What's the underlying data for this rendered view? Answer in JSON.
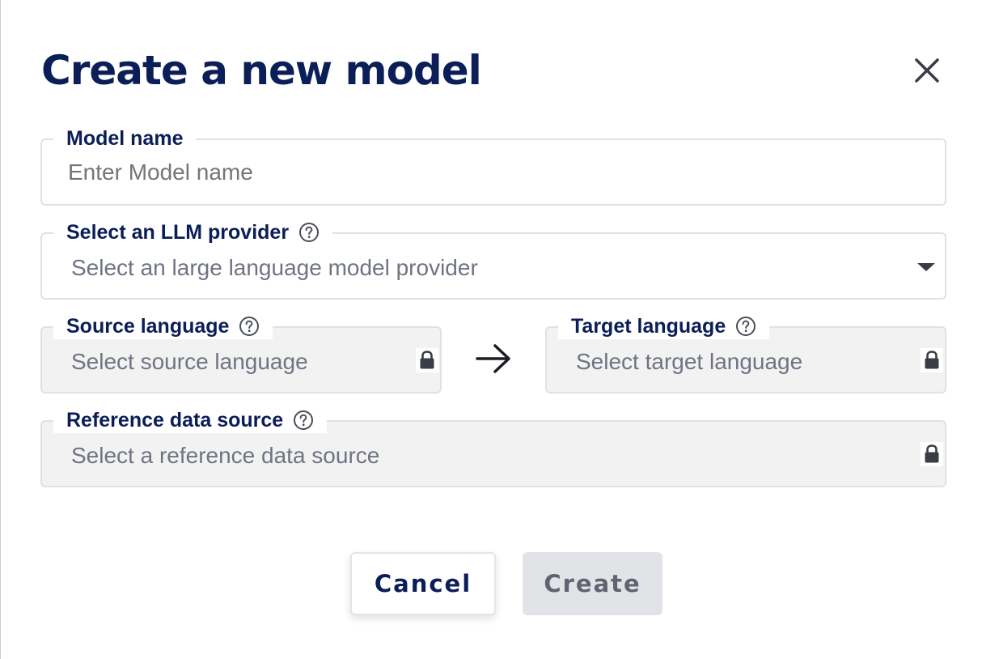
{
  "dialog": {
    "title": "Create a new model",
    "close_icon": "close-icon"
  },
  "fields": {
    "model_name": {
      "label": "Model name",
      "placeholder": "Enter Model name",
      "value": ""
    },
    "llm_provider": {
      "label": "Select an LLM provider",
      "placeholder": "Select an large language model provider",
      "help_icon": "help-icon",
      "dropdown_icon": "caret-down-icon"
    },
    "source_language": {
      "label": "Source language",
      "placeholder": "Select source language",
      "help_icon": "help-icon",
      "lock_icon": "lock-icon",
      "locked": true
    },
    "target_language": {
      "label": "Target language",
      "placeholder": "Select target language",
      "help_icon": "help-icon",
      "lock_icon": "lock-icon",
      "locked": true
    },
    "reference_source": {
      "label": "Reference data source",
      "placeholder": "Select a reference data source",
      "help_icon": "help-icon",
      "lock_icon": "lock-icon",
      "locked": true
    }
  },
  "language_arrow_icon": "arrow-right-icon",
  "buttons": {
    "cancel": "Cancel",
    "create": "Create",
    "create_disabled": true
  },
  "colors": {
    "primary_text": "#0b1e57",
    "placeholder_text": "#6f7482",
    "field_border": "#dfe1e7",
    "locked_background": "#f2f2f3",
    "disabled_button": "#e2e3e7"
  }
}
